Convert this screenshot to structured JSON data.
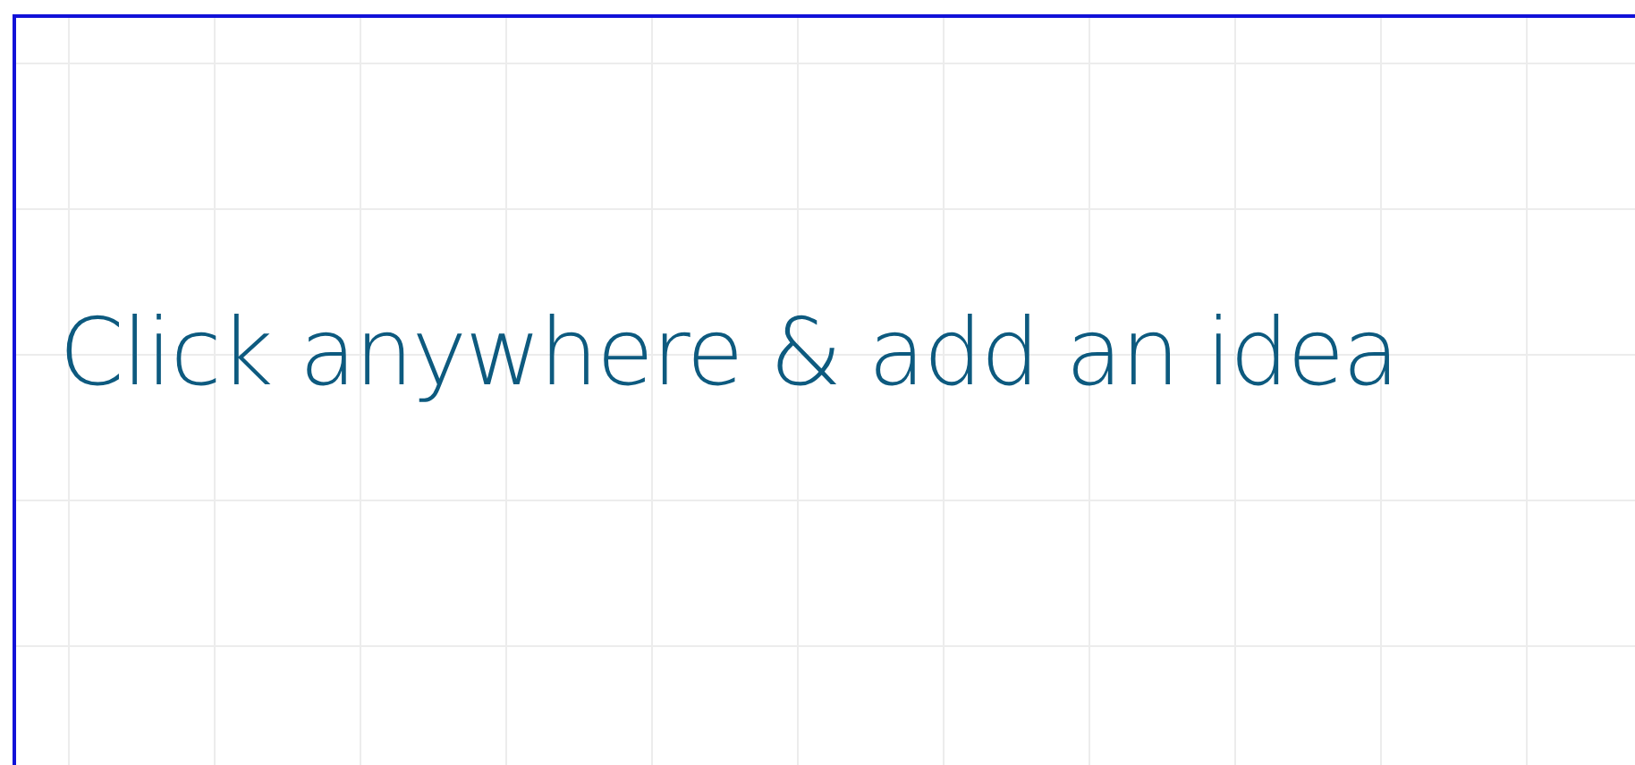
{
  "canvas": {
    "prompt": "Click anywhere & add an idea"
  }
}
